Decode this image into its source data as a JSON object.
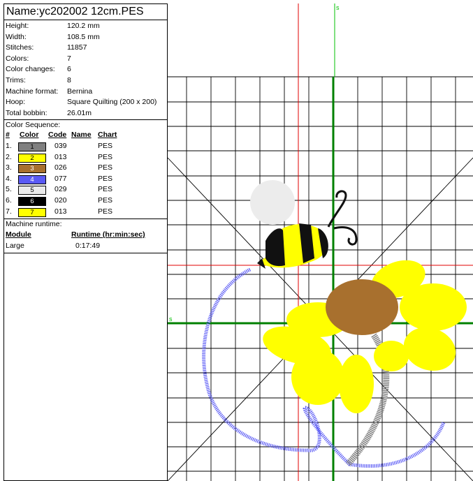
{
  "title": "Name:yc202002 12cm.PES",
  "properties": [
    {
      "label": "Height:",
      "value": "120.2 mm"
    },
    {
      "label": "Width:",
      "value": "108.5 mm"
    },
    {
      "label": "Stitches:",
      "value": "11857"
    },
    {
      "label": "Colors:",
      "value": "7"
    },
    {
      "label": "Color changes:",
      "value": "6"
    },
    {
      "label": "Trims:",
      "value": "8"
    },
    {
      "label": "Machine format:",
      "value": "Bernina"
    },
    {
      "label": "Hoop:",
      "value": "Square Quilting (200 x 200)"
    },
    {
      "label": "Total bobbin:",
      "value": "26.01m"
    }
  ],
  "color_sequence": {
    "heading": "Color Sequence:",
    "columns": [
      "#",
      "Color",
      "Code",
      "Name",
      "Chart"
    ],
    "rows": [
      {
        "index": "1.",
        "swatch": "1",
        "color": "#808080",
        "text_color": "#000000",
        "code": "039",
        "name": "",
        "chart": "PES"
      },
      {
        "index": "2.",
        "swatch": "2",
        "color": "#ffff00",
        "text_color": "#000000",
        "code": "013",
        "name": "",
        "chart": "PES"
      },
      {
        "index": "3.",
        "swatch": "3",
        "color": "#a8702e",
        "text_color": "#ffffff",
        "code": "026",
        "name": "",
        "chart": "PES"
      },
      {
        "index": "4.",
        "swatch": "4",
        "color": "#5a5af5",
        "text_color": "#ffffff",
        "code": "077",
        "name": "",
        "chart": "PES"
      },
      {
        "index": "5.",
        "swatch": "5",
        "color": "#ececec",
        "text_color": "#000000",
        "code": "029",
        "name": "",
        "chart": "PES"
      },
      {
        "index": "6.",
        "swatch": "6",
        "color": "#000000",
        "text_color": "#ffffff",
        "code": "020",
        "name": "",
        "chart": "PES"
      },
      {
        "index": "7.",
        "swatch": "7",
        "color": "#ffff00",
        "text_color": "#000000",
        "code": "013",
        "name": "",
        "chart": "PES"
      }
    ]
  },
  "runtime": {
    "heading": "Machine runtime:",
    "col_module": "Module",
    "col_runtime": "Runtime (hr:min:sec)",
    "rows": [
      {
        "module": "Large",
        "time": "0:17:49"
      }
    ]
  },
  "canvas": {
    "axis_marker": "s",
    "colors": {
      "grid": "#000000",
      "center_axis": "#008000",
      "center_marker": "#00c000",
      "crosshair": "#e00000",
      "petal": "#ffff00",
      "flower_center": "#a8702e",
      "stem": "#808080",
      "ring": "#5a5af5",
      "wing": "#e8e8e8",
      "bee_dark": "#000000"
    }
  }
}
